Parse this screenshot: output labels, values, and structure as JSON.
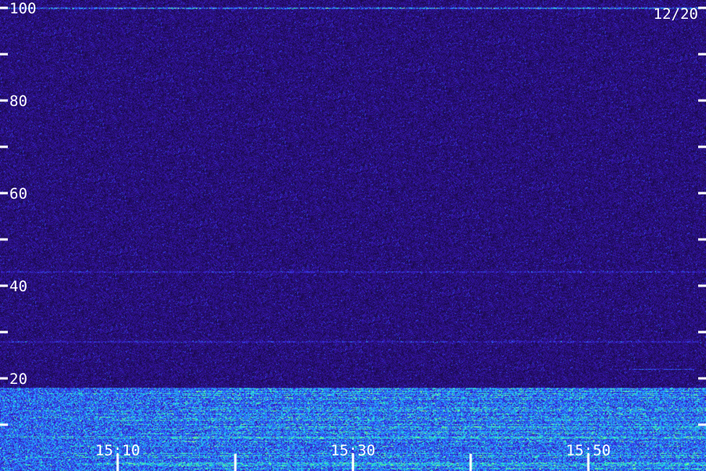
{
  "date_label": "12/20",
  "chart_data": {
    "type": "heatmap",
    "description_of_axes": {
      "y_tick_labels": [
        "100",
        "80",
        "60",
        "40",
        "20"
      ],
      "x_tick_labels": [
        "15:10",
        "15:30",
        "15:50"
      ]
    },
    "y_ticks_labeled": [
      100,
      80,
      60,
      40,
      20
    ],
    "y_ticks_minor": [
      90,
      70,
      50,
      30,
      10
    ],
    "ylim": [
      0,
      101.7
    ],
    "x_ticks_labeled": [
      "15:10",
      "15:30",
      "15:50"
    ],
    "x_ticks_unlabeled": [
      "15:20",
      "15:40",
      "16:00"
    ],
    "xlim": [
      "15:00",
      "16:00"
    ],
    "grid": false,
    "colormap": [
      "#000000",
      "#1a0a4a",
      "#2a1080",
      "#3a1ac0",
      "#3050ff",
      "#20c0ff",
      "#30ffb0",
      "#d0ff60"
    ],
    "features": [
      {
        "kind": "constant-line",
        "y": 100,
        "intensity": 0.7
      },
      {
        "kind": "strong-low-band",
        "y_range": [
          0,
          18
        ],
        "intensity": 0.9
      },
      {
        "kind": "weak-band",
        "y": 43,
        "intensity": 0.3
      },
      {
        "kind": "weak-band",
        "y": 28,
        "intensity": 0.3
      },
      {
        "kind": "segment",
        "y": 22,
        "x_range": [
          "15:53",
          "15:59"
        ],
        "intensity": 0.5
      }
    ]
  }
}
